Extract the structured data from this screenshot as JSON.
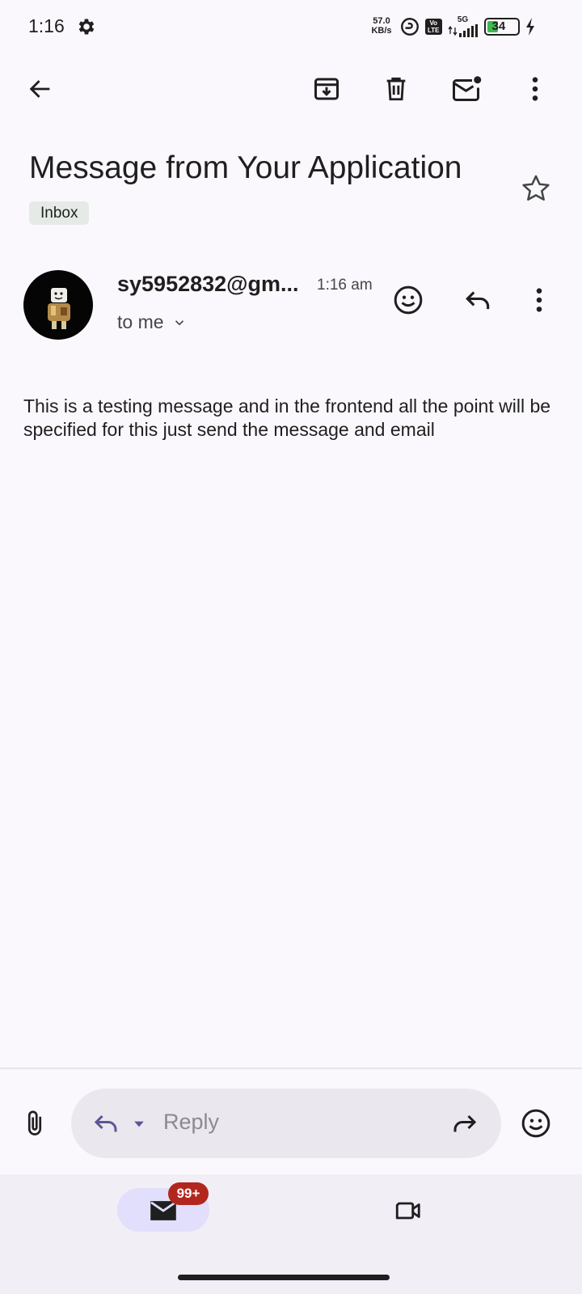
{
  "status_bar": {
    "time": "1:16",
    "net_speed_value": "57.0",
    "net_speed_unit": "KB/s",
    "volte_top": "Vo",
    "volte_bottom": "LTE",
    "network": "5G",
    "battery": "34",
    "battery_level": 0.34,
    "icons": [
      "settings-gear-icon",
      "hotspot-link-icon",
      "volte-icon",
      "signal-5g-icon",
      "battery-icon",
      "charging-bolt-icon"
    ]
  },
  "toolbar": {
    "icons": [
      "back-arrow-icon",
      "archive-icon",
      "delete-icon",
      "mark-unread-icon",
      "more-vert-icon"
    ]
  },
  "email": {
    "subject": "Message from Your Application",
    "label": "Inbox",
    "sender": "sy5952832@gm...",
    "time": "1:16 am",
    "recipient": "to me",
    "body": "This is a testing message and in the frontend all the point will be specified for this just send the message and email"
  },
  "reply_bar": {
    "placeholder": "Reply",
    "icons": [
      "attachment-icon",
      "reply-icon",
      "dropdown-caret-icon",
      "forward-icon",
      "emoji-icon"
    ]
  },
  "bottom_nav": {
    "mail_badge": "99+",
    "icons": [
      "mail-icon",
      "video-meet-icon"
    ]
  },
  "colors": {
    "background": "#fbf8fd",
    "accent": "#5d5599",
    "badge": "#b3261e",
    "battery": "#3fb84f",
    "nav_background": "#f1eef6",
    "nav_pill": "#e1dffb"
  }
}
